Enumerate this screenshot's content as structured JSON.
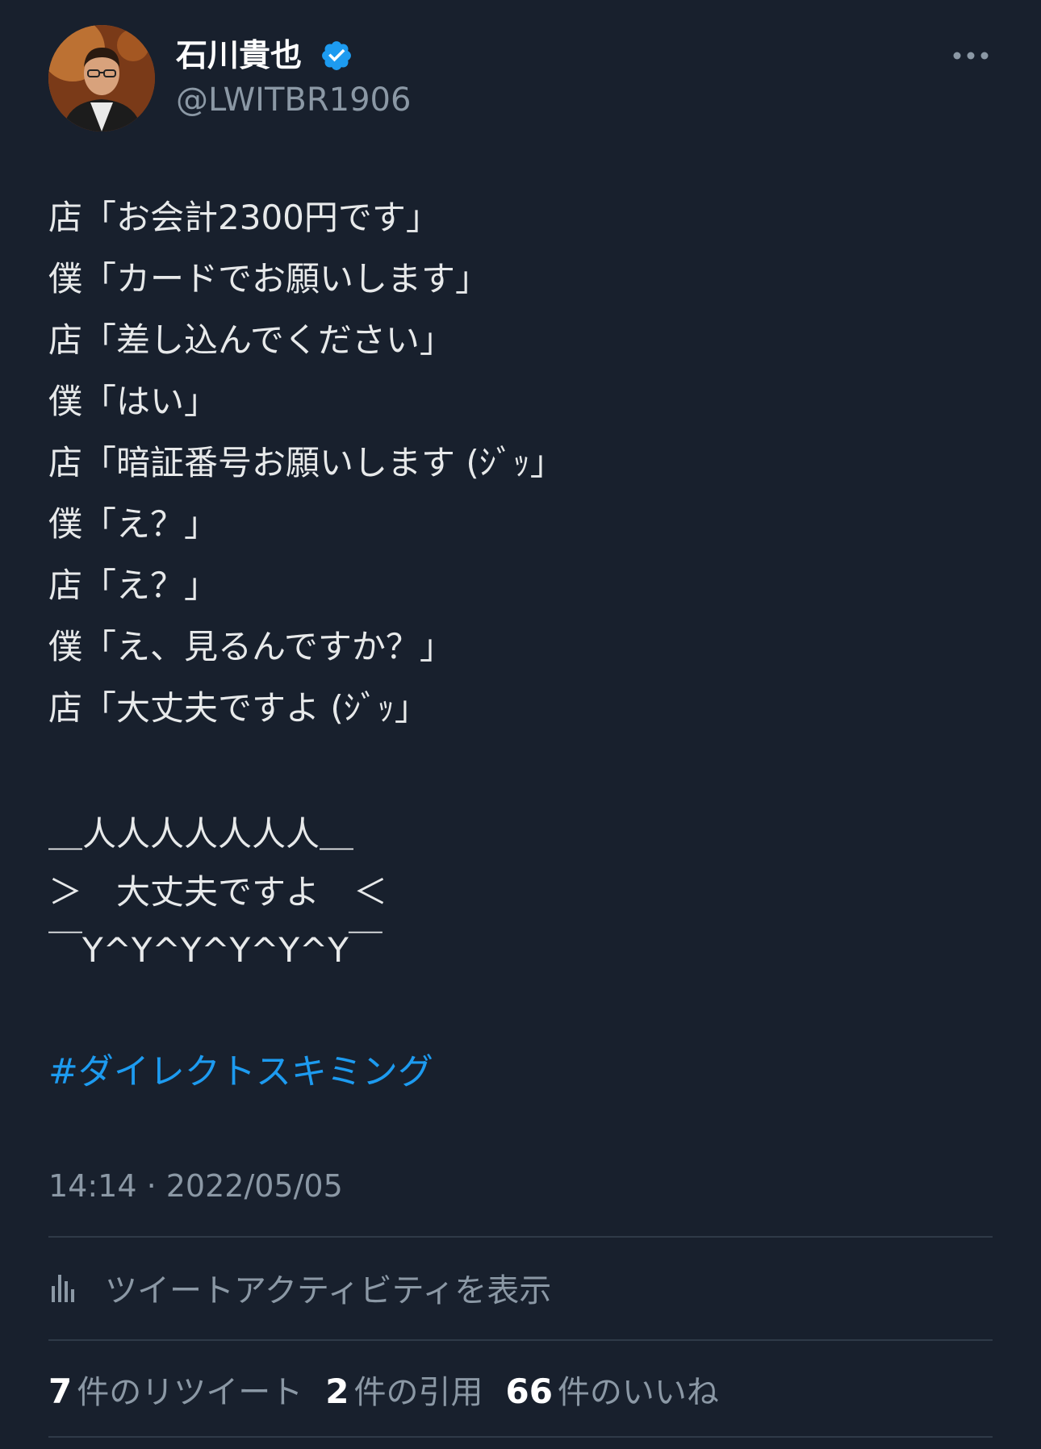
{
  "author": {
    "display_name": "石川貴也",
    "handle": "@LWITBR1906",
    "verified_icon": "verified-badge-icon",
    "avatar_icon": "profile-photo"
  },
  "tweet": {
    "lines": [
      "店「お会計2300円です」",
      "僕「カードでお願いします」",
      "店「差し込んでください」",
      "僕「はい」",
      "店「暗証番号お願いします (ｼﾞｯ」",
      "僕「え？」",
      "店「え？」",
      "僕「え、見るんですか？」",
      "店「大丈夫ですよ (ｼﾞｯ」"
    ],
    "ascii_art": [
      "＿人人人人人人人＿",
      "＞　大丈夫ですよ　＜",
      "￣Y^Y^Y^Y^Y^Y￣"
    ],
    "hashtag": "#ダイレクトスキミング",
    "timestamp": "14:14 · 2022/05/05"
  },
  "activity": {
    "label": "ツイートアクティビティを表示",
    "icon": "analytics-bar-icon"
  },
  "stats": {
    "retweets": {
      "count": "7",
      "label": "件のリツイート"
    },
    "quotes": {
      "count": "2",
      "label": "件の引用"
    },
    "likes": {
      "count": "66",
      "label": "件のいいね"
    }
  },
  "colors": {
    "background": "#18202d",
    "text": "#e7e9ea",
    "secondary": "#8b98a5",
    "accent": "#1d9bf0",
    "divider": "#2f3a48"
  }
}
